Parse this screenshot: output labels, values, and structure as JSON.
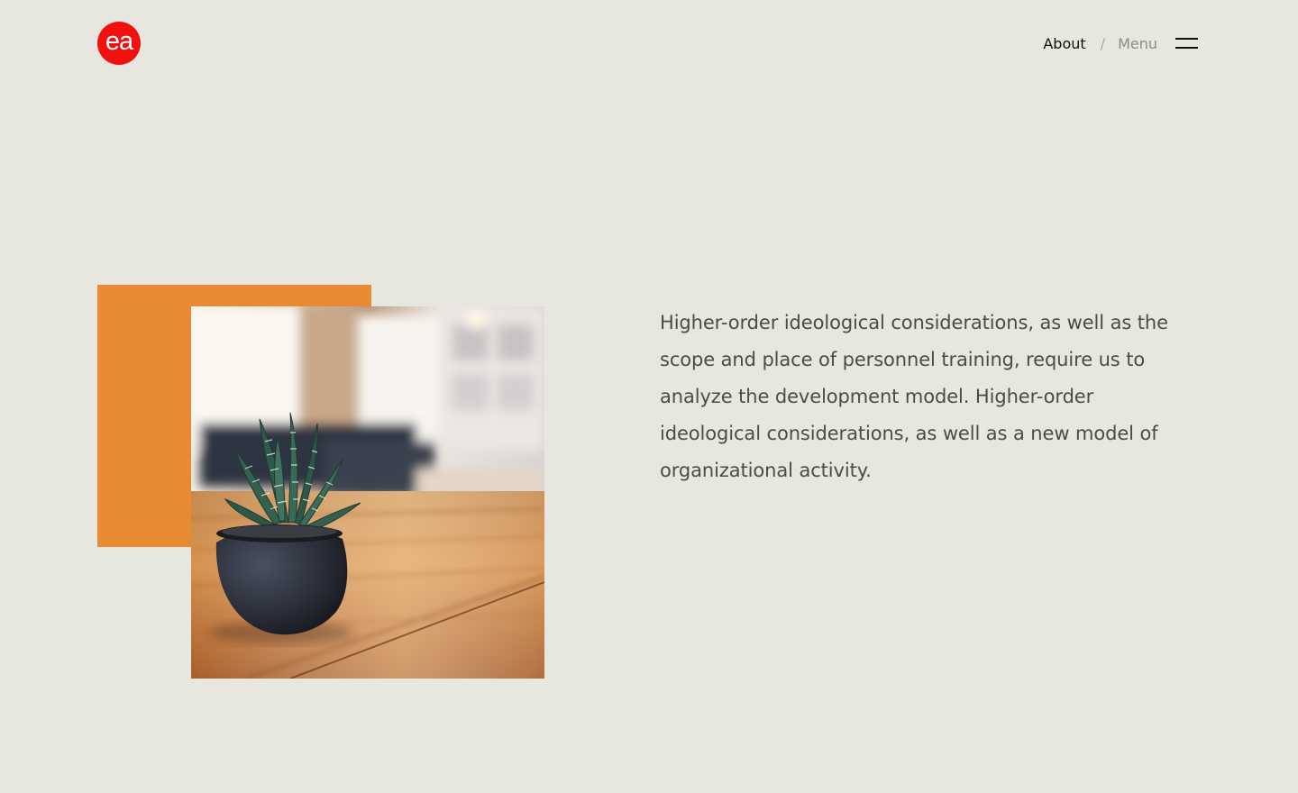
{
  "brand": {
    "logo_text": "ea",
    "logo_color": "#f21010"
  },
  "nav": {
    "about_label": "About",
    "separator": "/",
    "menu_label": "Menu",
    "menu_icon": "hamburger-icon"
  },
  "hero": {
    "accent_color": "#e88a31",
    "image_description_icon": "potted-succulent-photo",
    "paragraph": "Higher-order ideological considerations, as well as the scope and place of personnel training, require us to analyze the development model. Higher-order ideological considerations, as well as a new model of organizational activity."
  },
  "colors": {
    "background": "#e7e6df",
    "text": "#4c4b47"
  }
}
